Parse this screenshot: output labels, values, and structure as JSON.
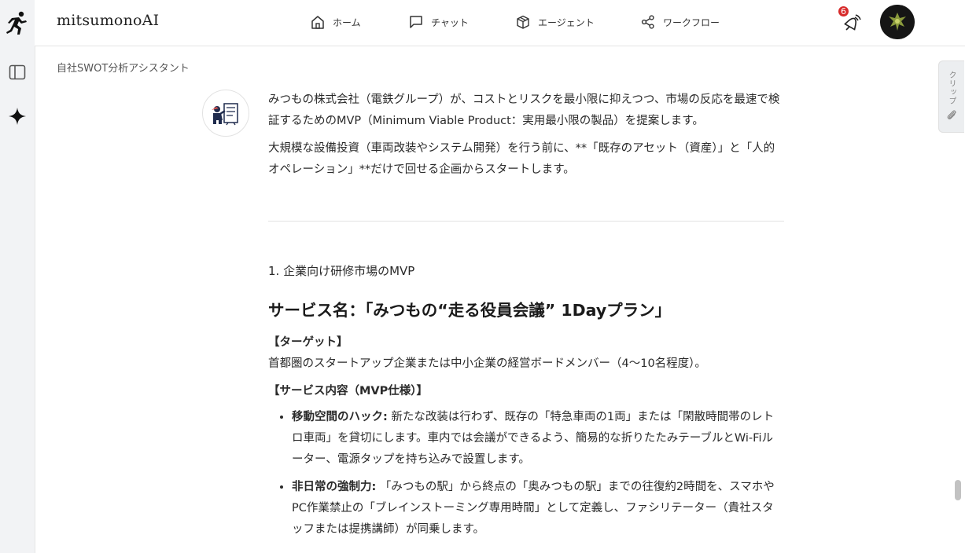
{
  "app": {
    "brand": "mitsumonoAI"
  },
  "nav": [
    {
      "label": "ホーム",
      "icon": "home-icon"
    },
    {
      "label": "チャット",
      "icon": "chat-icon"
    },
    {
      "label": "エージェント",
      "icon": "cube-icon"
    },
    {
      "label": "ワークフロー",
      "icon": "share-icon"
    }
  ],
  "notifications": {
    "count": "6"
  },
  "assistant": {
    "name": "自社SWOT分析アシスタント"
  },
  "message": {
    "intro1": "みつもの株式会社（電鉄グループ）が、コストとリスクを最小限に抑えつつ、市場の反応を最速で検証するためのMVP（Minimum Viable Product：実用最小限の製品）を提案します。",
    "intro2": "大規模な設備投資（車両改装やシステム開発）を行う前に、**「既存のアセット（資産）」と「人的オペレーション」**だけで回せる企画からスタートします。",
    "section_heading": "1. 企業向け研修市場のMVP",
    "service_title": "サービス名：「みつもの“走る役員会議” 1Dayプラン」",
    "target_label": "【ターゲット】",
    "target_text": "首都圏のスタートアップ企業または中小企業の経営ボードメンバー（4〜10名程度）。",
    "spec_label": "【サービス内容（MVP仕様）】",
    "bullets": [
      {
        "term": "移動空間のハック:",
        "text": " 新たな改装は行わず、既存の「特急車両の1両」または「閑散時間帯のレトロ車両」を貸切にします。車内では会議ができるよう、簡易的な折りたたみテーブルとWi-Fiルーター、電源タップを持ち込みで設置します。"
      },
      {
        "term": "非日常の強制力:",
        "text": " 「みつもの駅」から終点の「奥みつもの駅」までの往復約2時間を、スマホやPC作業禁止の「ブレインストーミング専用時間」として定義し、ファシリテーター（貴社スタッフまたは提携講師）が同乗します。"
      }
    ]
  },
  "clip_panel": {
    "label": "クリップ"
  },
  "colors": {
    "badge": "#d72b2b",
    "rail": "#f2f3f5",
    "avatar_bg": "#151515"
  }
}
